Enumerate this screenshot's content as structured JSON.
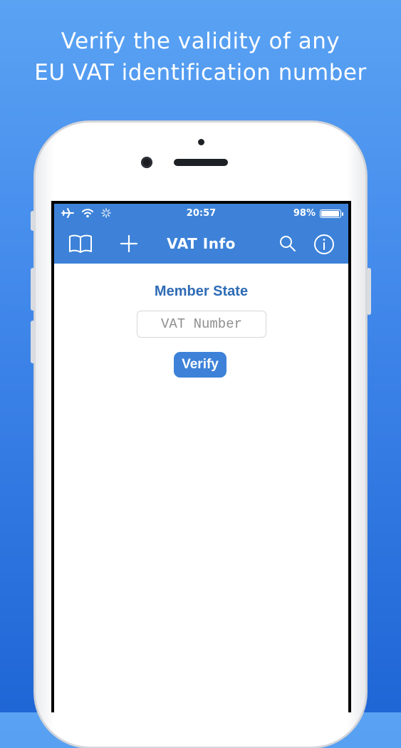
{
  "promo": {
    "line1": "Verify the validity of any",
    "line2": "EU VAT identification number"
  },
  "status_bar": {
    "time": "20:57",
    "battery": "98%",
    "battery_level": 0.98,
    "icons": [
      "airplane-icon",
      "wifi-icon",
      "activity-spinner-icon"
    ]
  },
  "toolbar": {
    "title": "VAT Info",
    "icons": [
      "book-icon",
      "plus-icon",
      "search-icon",
      "info-icon"
    ]
  },
  "form": {
    "member_state_label": "Member State",
    "vat_placeholder": "VAT Number",
    "vat_value": "",
    "verify_label": "Verify"
  },
  "colors": {
    "accent": "#3d82d8",
    "label": "#2e6bb5",
    "background_top": "#5aa3f3",
    "background_bottom": "#1f66d6"
  }
}
